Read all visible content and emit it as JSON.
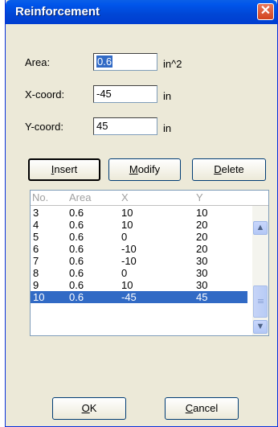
{
  "window": {
    "title": "Reinforcement"
  },
  "fields": {
    "area": {
      "label": "Area:",
      "value": "0.6",
      "unit": "in^2"
    },
    "xcoord": {
      "label": "X-coord:",
      "value": "-45",
      "unit": "in"
    },
    "ycoord": {
      "label": "Y-coord:",
      "value": "45",
      "unit": "in"
    }
  },
  "buttons": {
    "insert": {
      "pre": "",
      "key": "I",
      "post": "nsert"
    },
    "modify": {
      "pre": "",
      "key": "M",
      "post": "odify"
    },
    "delete": {
      "pre": "",
      "key": "D",
      "post": "elete"
    },
    "ok": {
      "pre": "",
      "key": "O",
      "post": "K"
    },
    "cancel": {
      "pre": "",
      "key": "C",
      "post": "ancel"
    }
  },
  "list": {
    "headers": [
      "No.",
      "Area",
      "X",
      "Y"
    ],
    "rows": [
      [
        "3",
        "0.6",
        "10",
        "10"
      ],
      [
        "4",
        "0.6",
        "10",
        "20"
      ],
      [
        "5",
        "0.6",
        "0",
        "20"
      ],
      [
        "6",
        "0.6",
        "-10",
        "20"
      ],
      [
        "7",
        "0.6",
        "-10",
        "30"
      ],
      [
        "8",
        "0.6",
        "0",
        "30"
      ],
      [
        "9",
        "0.6",
        "10",
        "30"
      ],
      [
        "10",
        "0.6",
        "-45",
        "45"
      ]
    ],
    "selected_row": "10"
  },
  "icons": {
    "close": "close-icon",
    "scroll_up": "chevron-up-icon",
    "scroll_down": "chevron-down-icon"
  }
}
